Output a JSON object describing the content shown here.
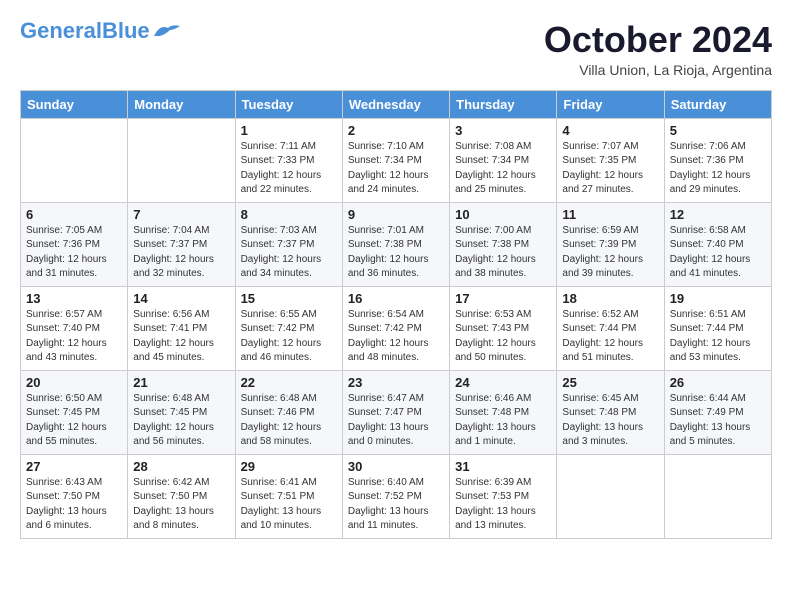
{
  "header": {
    "logo_general": "General",
    "logo_blue": "Blue",
    "month_title": "October 2024",
    "subtitle": "Villa Union, La Rioja, Argentina"
  },
  "weekdays": [
    "Sunday",
    "Monday",
    "Tuesday",
    "Wednesday",
    "Thursday",
    "Friday",
    "Saturday"
  ],
  "weeks": [
    [
      null,
      null,
      {
        "day": "1",
        "sunrise": "Sunrise: 7:11 AM",
        "sunset": "Sunset: 7:33 PM",
        "daylight": "Daylight: 12 hours and 22 minutes."
      },
      {
        "day": "2",
        "sunrise": "Sunrise: 7:10 AM",
        "sunset": "Sunset: 7:34 PM",
        "daylight": "Daylight: 12 hours and 24 minutes."
      },
      {
        "day": "3",
        "sunrise": "Sunrise: 7:08 AM",
        "sunset": "Sunset: 7:34 PM",
        "daylight": "Daylight: 12 hours and 25 minutes."
      },
      {
        "day": "4",
        "sunrise": "Sunrise: 7:07 AM",
        "sunset": "Sunset: 7:35 PM",
        "daylight": "Daylight: 12 hours and 27 minutes."
      },
      {
        "day": "5",
        "sunrise": "Sunrise: 7:06 AM",
        "sunset": "Sunset: 7:36 PM",
        "daylight": "Daylight: 12 hours and 29 minutes."
      }
    ],
    [
      {
        "day": "6",
        "sunrise": "Sunrise: 7:05 AM",
        "sunset": "Sunset: 7:36 PM",
        "daylight": "Daylight: 12 hours and 31 minutes."
      },
      {
        "day": "7",
        "sunrise": "Sunrise: 7:04 AM",
        "sunset": "Sunset: 7:37 PM",
        "daylight": "Daylight: 12 hours and 32 minutes."
      },
      {
        "day": "8",
        "sunrise": "Sunrise: 7:03 AM",
        "sunset": "Sunset: 7:37 PM",
        "daylight": "Daylight: 12 hours and 34 minutes."
      },
      {
        "day": "9",
        "sunrise": "Sunrise: 7:01 AM",
        "sunset": "Sunset: 7:38 PM",
        "daylight": "Daylight: 12 hours and 36 minutes."
      },
      {
        "day": "10",
        "sunrise": "Sunrise: 7:00 AM",
        "sunset": "Sunset: 7:38 PM",
        "daylight": "Daylight: 12 hours and 38 minutes."
      },
      {
        "day": "11",
        "sunrise": "Sunrise: 6:59 AM",
        "sunset": "Sunset: 7:39 PM",
        "daylight": "Daylight: 12 hours and 39 minutes."
      },
      {
        "day": "12",
        "sunrise": "Sunrise: 6:58 AM",
        "sunset": "Sunset: 7:40 PM",
        "daylight": "Daylight: 12 hours and 41 minutes."
      }
    ],
    [
      {
        "day": "13",
        "sunrise": "Sunrise: 6:57 AM",
        "sunset": "Sunset: 7:40 PM",
        "daylight": "Daylight: 12 hours and 43 minutes."
      },
      {
        "day": "14",
        "sunrise": "Sunrise: 6:56 AM",
        "sunset": "Sunset: 7:41 PM",
        "daylight": "Daylight: 12 hours and 45 minutes."
      },
      {
        "day": "15",
        "sunrise": "Sunrise: 6:55 AM",
        "sunset": "Sunset: 7:42 PM",
        "daylight": "Daylight: 12 hours and 46 minutes."
      },
      {
        "day": "16",
        "sunrise": "Sunrise: 6:54 AM",
        "sunset": "Sunset: 7:42 PM",
        "daylight": "Daylight: 12 hours and 48 minutes."
      },
      {
        "day": "17",
        "sunrise": "Sunrise: 6:53 AM",
        "sunset": "Sunset: 7:43 PM",
        "daylight": "Daylight: 12 hours and 50 minutes."
      },
      {
        "day": "18",
        "sunrise": "Sunrise: 6:52 AM",
        "sunset": "Sunset: 7:44 PM",
        "daylight": "Daylight: 12 hours and 51 minutes."
      },
      {
        "day": "19",
        "sunrise": "Sunrise: 6:51 AM",
        "sunset": "Sunset: 7:44 PM",
        "daylight": "Daylight: 12 hours and 53 minutes."
      }
    ],
    [
      {
        "day": "20",
        "sunrise": "Sunrise: 6:50 AM",
        "sunset": "Sunset: 7:45 PM",
        "daylight": "Daylight: 12 hours and 55 minutes."
      },
      {
        "day": "21",
        "sunrise": "Sunrise: 6:48 AM",
        "sunset": "Sunset: 7:45 PM",
        "daylight": "Daylight: 12 hours and 56 minutes."
      },
      {
        "day": "22",
        "sunrise": "Sunrise: 6:48 AM",
        "sunset": "Sunset: 7:46 PM",
        "daylight": "Daylight: 12 hours and 58 minutes."
      },
      {
        "day": "23",
        "sunrise": "Sunrise: 6:47 AM",
        "sunset": "Sunset: 7:47 PM",
        "daylight": "Daylight: 13 hours and 0 minutes."
      },
      {
        "day": "24",
        "sunrise": "Sunrise: 6:46 AM",
        "sunset": "Sunset: 7:48 PM",
        "daylight": "Daylight: 13 hours and 1 minute."
      },
      {
        "day": "25",
        "sunrise": "Sunrise: 6:45 AM",
        "sunset": "Sunset: 7:48 PM",
        "daylight": "Daylight: 13 hours and 3 minutes."
      },
      {
        "day": "26",
        "sunrise": "Sunrise: 6:44 AM",
        "sunset": "Sunset: 7:49 PM",
        "daylight": "Daylight: 13 hours and 5 minutes."
      }
    ],
    [
      {
        "day": "27",
        "sunrise": "Sunrise: 6:43 AM",
        "sunset": "Sunset: 7:50 PM",
        "daylight": "Daylight: 13 hours and 6 minutes."
      },
      {
        "day": "28",
        "sunrise": "Sunrise: 6:42 AM",
        "sunset": "Sunset: 7:50 PM",
        "daylight": "Daylight: 13 hours and 8 minutes."
      },
      {
        "day": "29",
        "sunrise": "Sunrise: 6:41 AM",
        "sunset": "Sunset: 7:51 PM",
        "daylight": "Daylight: 13 hours and 10 minutes."
      },
      {
        "day": "30",
        "sunrise": "Sunrise: 6:40 AM",
        "sunset": "Sunset: 7:52 PM",
        "daylight": "Daylight: 13 hours and 11 minutes."
      },
      {
        "day": "31",
        "sunrise": "Sunrise: 6:39 AM",
        "sunset": "Sunset: 7:53 PM",
        "daylight": "Daylight: 13 hours and 13 minutes."
      },
      null,
      null
    ]
  ]
}
